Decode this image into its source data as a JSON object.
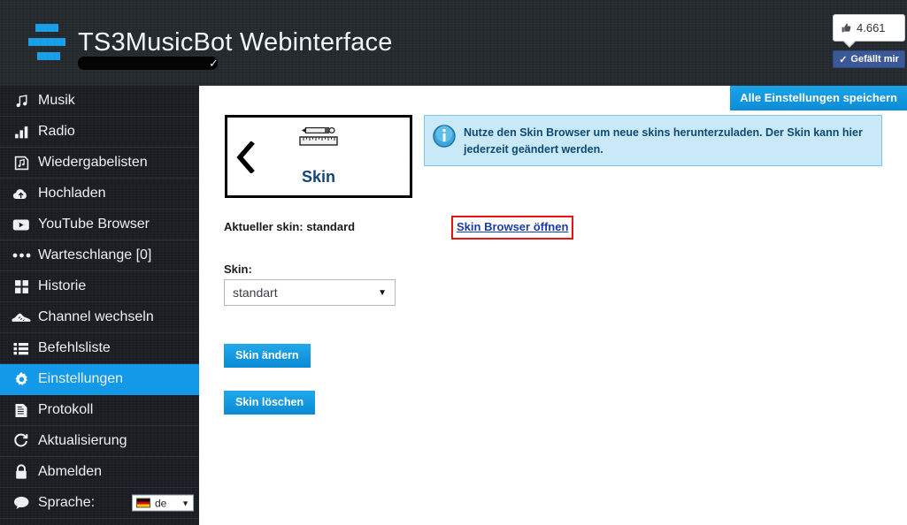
{
  "header": {
    "logo_icon": "bars-logo-icon",
    "title": "TS3MusicBot Webinterface",
    "redacted_subtitle": "",
    "verified_icon": "check-icon",
    "facebook": {
      "like_count": "4.661",
      "thumb_icon": "thumbs-up-icon",
      "like_label": "Gefällt mir",
      "like_check_icon": "check-icon",
      "brand_color": "#3b5998"
    }
  },
  "sidebar": {
    "items": [
      {
        "icon": "music-note-icon",
        "label": "Musik",
        "active": false
      },
      {
        "icon": "bar-chart-icon",
        "label": "Radio",
        "active": false
      },
      {
        "icon": "playlist-icon",
        "label": "Wiedergabelisten",
        "active": false
      },
      {
        "icon": "cloud-upload-icon",
        "label": "Hochladen",
        "active": false
      },
      {
        "icon": "youtube-icon",
        "label": "YouTube Browser",
        "active": false
      },
      {
        "icon": "dots-icon",
        "label": "Warteschlange [0]",
        "active": false
      },
      {
        "icon": "grid-icon",
        "label": "Historie",
        "active": false
      },
      {
        "icon": "shoe-icon",
        "label": "Channel wechseln",
        "active": false
      },
      {
        "icon": "list-icon",
        "label": "Befehlsliste",
        "active": false
      },
      {
        "icon": "gear-icon",
        "label": "Einstellungen",
        "active": true
      },
      {
        "icon": "document-icon",
        "label": "Protokoll",
        "active": false
      },
      {
        "icon": "refresh-icon",
        "label": "Aktualisierung",
        "active": false
      },
      {
        "icon": "lock-icon",
        "label": "Abmelden",
        "active": false
      },
      {
        "icon": "speech-bubble-icon",
        "label": "Sprache:",
        "active": false
      }
    ],
    "language": {
      "flag_icon": "german-flag-icon",
      "value": "de",
      "caret_icon": "chevron-down-icon"
    },
    "active_color": "#129ae8"
  },
  "content": {
    "save_all_label": "Alle Einstellungen speichern",
    "panel": {
      "back_icon": "chevron-left-icon",
      "header_icon": "pencil-ruler-icon",
      "title": "Skin"
    },
    "infobox": {
      "icon": "info-icon",
      "text": "Nutze den Skin Browser um neue skins herunterzuladen. Der Skin kann hier jederzeit geändert werden.",
      "background_color": "#c9e9f9",
      "text_color": "#0e4a72"
    },
    "current_skin_label": "Aktueller skin: standard",
    "browser_link_label": "Skin Browser öffnen",
    "browser_link_highlight_color": "#e81414",
    "skin_field_label": "Skin:",
    "skin_select": {
      "value": "standart",
      "caret_icon": "chevron-down-icon"
    },
    "buttons": {
      "change_label": "Skin ändern",
      "delete_label": "Skin löschen"
    },
    "accent_color": "#129ae8"
  }
}
